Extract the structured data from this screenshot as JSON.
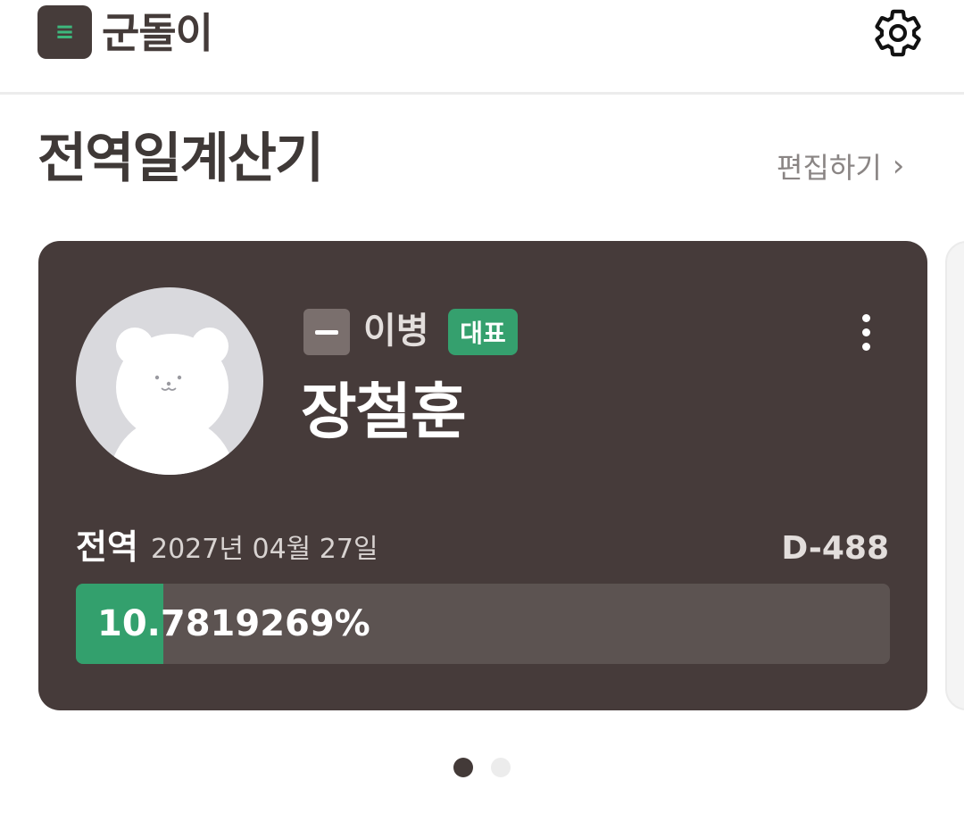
{
  "app": {
    "title": "군돌이",
    "logo_icon": "menu-lines-icon",
    "settings_icon": "gear-icon"
  },
  "section": {
    "title": "전역일계산기",
    "edit_label": "편집하기",
    "edit_chevron": "›"
  },
  "card": {
    "rank_icon": "rank-private-first-class-icon",
    "rank": "이병",
    "badge": "대표",
    "more_icon": "more-vertical-icon",
    "name": "장철훈",
    "discharge_label": "전역",
    "discharge_date": "2027년 04월 27일",
    "dday": "D-488",
    "progress_text": "10.7819269%",
    "progress_fraction": 0.107819269
  },
  "pager": {
    "count": 2,
    "active_index": 0
  },
  "colors": {
    "brand_dark": "#463b3a",
    "accent_green": "#33a06d",
    "track": "#5c5351"
  }
}
